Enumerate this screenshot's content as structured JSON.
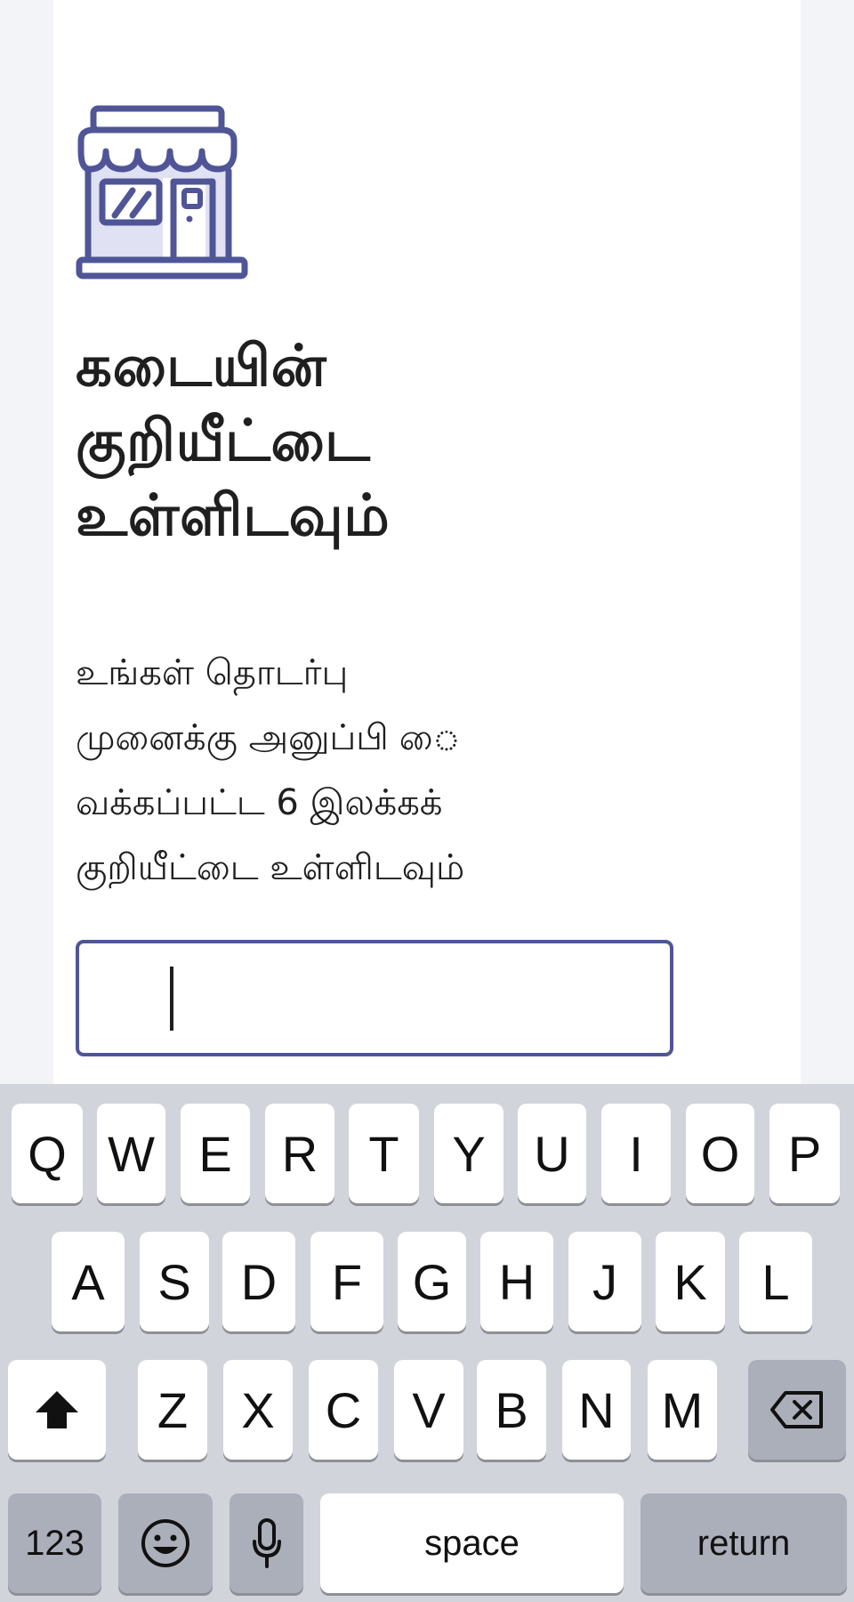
{
  "page": {
    "title_line1": "கடையின்",
    "title_line2": "குறியீட்டை",
    "title_line3": "உள்ளிடவும்",
    "desc_line1": "உங்கள் தொடர்பு",
    "desc_line2": "முனைக்கு அனுப்பி ை",
    "desc_line3": "வக்கப்பட்ட 6 இலக்கக்",
    "desc_line4": "குறியீட்டை உள்ளிடவும்",
    "code_input_value": ""
  },
  "icons": {
    "store": "store-icon",
    "shift": "shift-arrow-icon",
    "backspace": "backspace-icon",
    "emoji": "emoji-icon",
    "mic": "microphone-icon"
  },
  "colors": {
    "accent": "#4f5596",
    "icon_fill": "#e0e1f3",
    "keyboard_bg": "#d1d4db",
    "key_dark": "#abafba"
  },
  "keyboard": {
    "row1": [
      "Q",
      "W",
      "E",
      "R",
      "T",
      "Y",
      "U",
      "I",
      "O",
      "P"
    ],
    "row2": [
      "A",
      "S",
      "D",
      "F",
      "G",
      "H",
      "J",
      "K",
      "L"
    ],
    "row3": [
      "Z",
      "X",
      "C",
      "V",
      "B",
      "N",
      "M"
    ],
    "numbers_label": "123",
    "space_label": "space",
    "return_label": "return"
  }
}
